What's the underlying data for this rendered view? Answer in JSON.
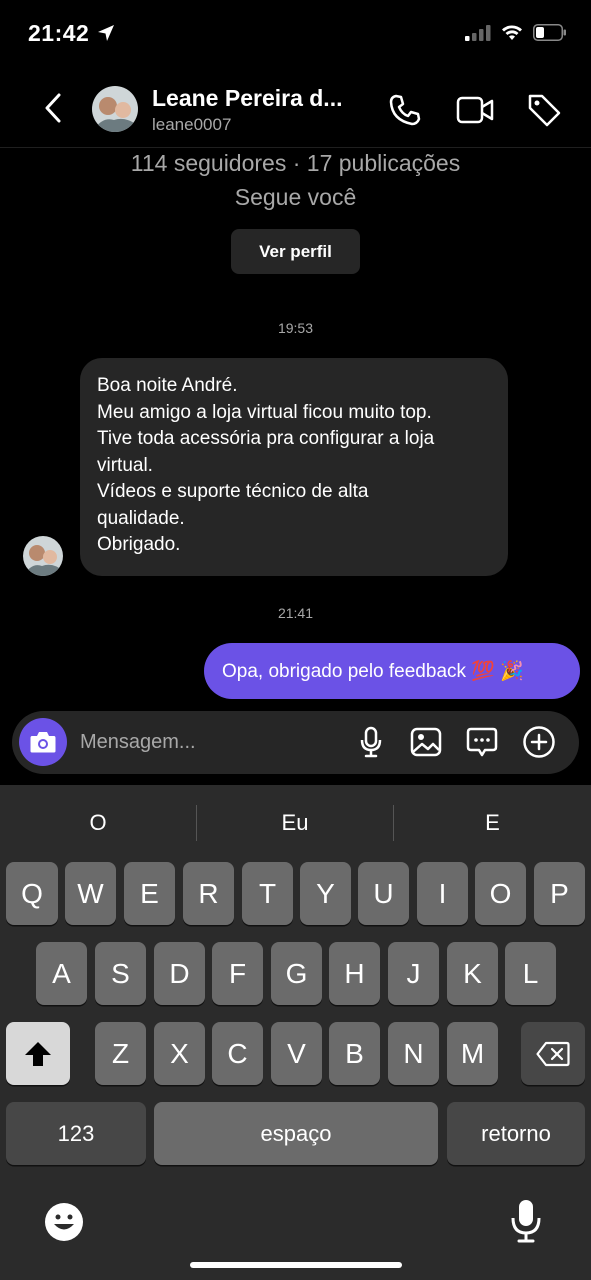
{
  "status_bar": {
    "time": "21:42"
  },
  "header": {
    "name": "Leane Pereira d...",
    "username": "leane0007"
  },
  "profile": {
    "stats": "114 seguidores · 17 publicações",
    "follows": "Segue você",
    "view_profile_label": "Ver perfil"
  },
  "messages": [
    {
      "timestamp": "19:53",
      "lines": [
        "Boa noite André.",
        "Meu amigo a loja virtual ficou muito top.",
        "Tive toda  acessória pra configurar a loja",
        "virtual.",
        "Vídeos e suporte técnico de alta",
        "qualidade.",
        "Obrigado."
      ]
    },
    {
      "timestamp": "21:41",
      "text": "Opa, obrigado pelo feedback 💯 🎉"
    }
  ],
  "composer": {
    "placeholder": "Mensagem..."
  },
  "keyboard": {
    "suggestions": [
      "O",
      "Eu",
      "E"
    ],
    "row1": [
      "Q",
      "W",
      "E",
      "R",
      "T",
      "Y",
      "U",
      "I",
      "O",
      "P"
    ],
    "row2": [
      "A",
      "S",
      "D",
      "F",
      "G",
      "H",
      "J",
      "K",
      "L"
    ],
    "row3": [
      "Z",
      "X",
      "C",
      "V",
      "B",
      "N",
      "M"
    ],
    "numbers_label": "123",
    "space_label": "espaço",
    "return_label": "retorno"
  },
  "colors": {
    "accent": "#6b52e6",
    "bubble_in": "#262626",
    "background": "#000000"
  }
}
